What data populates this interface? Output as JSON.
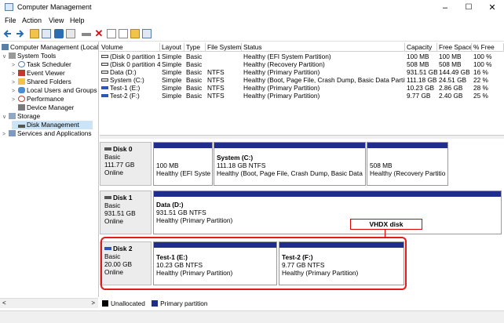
{
  "window": {
    "title": "Computer Management",
    "controls": [
      "–",
      "☐",
      "✕"
    ]
  },
  "menu": [
    "File",
    "Action",
    "View",
    "Help"
  ],
  "toolbar_icons": [
    "back-arrow-icon",
    "forward-arrow-icon",
    "up-folder-icon",
    "show-hide-tree-icon",
    "help-icon",
    "properties-icon",
    "delete-icon",
    "check-icon",
    "new-icon",
    "folder-icon",
    "view-icon"
  ],
  "tree": [
    {
      "label": "Computer Management (Local",
      "indent": 0,
      "caret": "",
      "icon": "computer-icon"
    },
    {
      "label": "System Tools",
      "indent": 1,
      "caret": "∨",
      "icon": "tools-icon"
    },
    {
      "label": "Task Scheduler",
      "indent": 2,
      "caret": ">",
      "icon": "clock-icon"
    },
    {
      "label": "Event Viewer",
      "indent": 2,
      "caret": ">",
      "icon": "event-viewer-icon"
    },
    {
      "label": "Shared Folders",
      "indent": 2,
      "caret": ">",
      "icon": "shared-folder-icon"
    },
    {
      "label": "Local Users and Groups",
      "indent": 2,
      "caret": ">",
      "icon": "users-icon"
    },
    {
      "label": "Performance",
      "indent": 2,
      "caret": ">",
      "icon": "performance-icon"
    },
    {
      "label": "Device Manager",
      "indent": 2,
      "caret": "",
      "icon": "device-manager-icon"
    },
    {
      "label": "Storage",
      "indent": 1,
      "caret": "∨",
      "icon": "storage-icon"
    },
    {
      "label": "Disk Management",
      "indent": 2,
      "caret": "",
      "icon": "disk-icon",
      "selected": true
    },
    {
      "label": "Services and Applications",
      "indent": 1,
      "caret": ">",
      "icon": "services-icon"
    }
  ],
  "volume_list": {
    "headers": [
      "Volume",
      "Layout",
      "Type",
      "File System",
      "Status",
      "Capacity",
      "Free Space",
      "% Free"
    ],
    "rows": [
      {
        "volume": "(Disk 0 partition 1)",
        "layout": "Simple",
        "type": "Basic",
        "fs": "",
        "status": "Healthy (EFI System Partition)",
        "capacity": "100 MB",
        "free": "100 MB",
        "pct": "100 %",
        "icon": "gray"
      },
      {
        "volume": "(Disk 0 partition 4)",
        "layout": "Simple",
        "type": "Basic",
        "fs": "",
        "status": "Healthy (Recovery Partition)",
        "capacity": "508 MB",
        "free": "508 MB",
        "pct": "100 %",
        "icon": "gray"
      },
      {
        "volume": "Data (D:)",
        "layout": "Simple",
        "type": "Basic",
        "fs": "NTFS",
        "status": "Healthy (Primary Partition)",
        "capacity": "931.51 GB",
        "free": "144.49 GB",
        "pct": "16 %",
        "icon": "gray"
      },
      {
        "volume": "System (C:)",
        "layout": "Simple",
        "type": "Basic",
        "fs": "NTFS",
        "status": "Healthy (Boot, Page File, Crash Dump, Basic Data Partiti...",
        "capacity": "111.18 GB",
        "free": "24.51 GB",
        "pct": "22 %",
        "icon": "gray"
      },
      {
        "volume": "Test-1 (E:)",
        "layout": "Simple",
        "type": "Basic",
        "fs": "NTFS",
        "status": "Healthy (Primary Partition)",
        "capacity": "10.23 GB",
        "free": "2.86 GB",
        "pct": "28 %",
        "icon": "blue"
      },
      {
        "volume": "Test-2 (F:)",
        "layout": "Simple",
        "type": "Basic",
        "fs": "NTFS",
        "status": "Healthy (Primary Partition)",
        "capacity": "9.77 GB",
        "free": "2.40 GB",
        "pct": "25 %",
        "icon": "blue"
      }
    ]
  },
  "disks": [
    {
      "name": "Disk 0",
      "type": "Basic",
      "size": "111.77 GB",
      "state": "Online",
      "partitions": [
        {
          "name": "",
          "size": "100 MB",
          "status": "Healthy (EFI System"
        },
        {
          "name": "System  (C:)",
          "size": "111.18 GB NTFS",
          "status": "Healthy (Boot, Page File, Crash Dump, Basic Data Part"
        },
        {
          "name": "",
          "size": "508 MB",
          "status": "Healthy (Recovery Partition)"
        }
      ]
    },
    {
      "name": "Disk 1",
      "type": "Basic",
      "size": "931.51 GB",
      "state": "Online",
      "partitions": [
        {
          "name": "Data  (D:)",
          "size": "931.51 GB NTFS",
          "status": "Healthy (Primary Partition)"
        }
      ]
    },
    {
      "name": "Disk 2",
      "type": "Basic",
      "size": "20.00 GB",
      "state": "Online",
      "partitions": [
        {
          "name": "Test-1  (E:)",
          "size": "10.23 GB NTFS",
          "status": "Healthy (Primary Partition)"
        },
        {
          "name": "Test-2  (F:)",
          "size": "9.77 GB NTFS",
          "status": "Healthy (Primary Partition)"
        }
      ]
    }
  ],
  "callout": "VHDX disk",
  "legend": [
    {
      "label": "Unallocated",
      "color": "#000000"
    },
    {
      "label": "Primary partition",
      "color": "#1f2e8c"
    }
  ]
}
